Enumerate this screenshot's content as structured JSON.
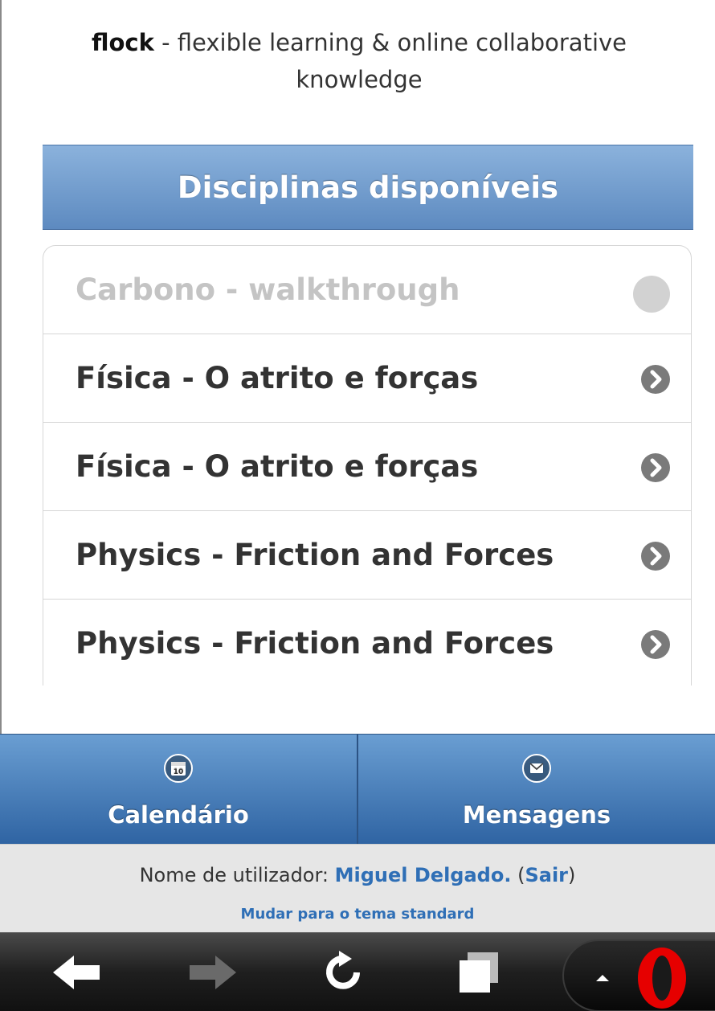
{
  "header": {
    "brand": "flock",
    "tagline": " - flexible learning & online collaborative knowledge"
  },
  "list": {
    "title": "Disciplinas disponíveis",
    "items": [
      {
        "label": "Carbono - walkthrough",
        "enabled": false
      },
      {
        "label": "Física - O atrito e forças",
        "enabled": true
      },
      {
        "label": "Física - O atrito e forças",
        "enabled": true
      },
      {
        "label": "Physics - Friction and Forces",
        "enabled": true
      },
      {
        "label": "Physics - Friction and Forces",
        "enabled": true
      }
    ]
  },
  "navbar": {
    "calendar": {
      "label": "Calendário",
      "icon": "calendar-icon",
      "day": "10"
    },
    "messages": {
      "label": "Mensagens",
      "icon": "envelope-icon"
    }
  },
  "footer": {
    "user_prefix": "Nome de utilizador: ",
    "user_name": "Miguel Delgado.",
    "open_paren": " (",
    "logout": "Sair",
    "close_paren": ")",
    "theme_link": "Mudar para o tema standard"
  },
  "browser": {
    "buttons": [
      "back-icon",
      "forward-icon",
      "reload-icon",
      "tabs-icon",
      "opera-menu-icon"
    ]
  },
  "colors": {
    "accent": "#5d8ac0",
    "link": "#2f6fb6",
    "navbar": "#2f64a3"
  }
}
